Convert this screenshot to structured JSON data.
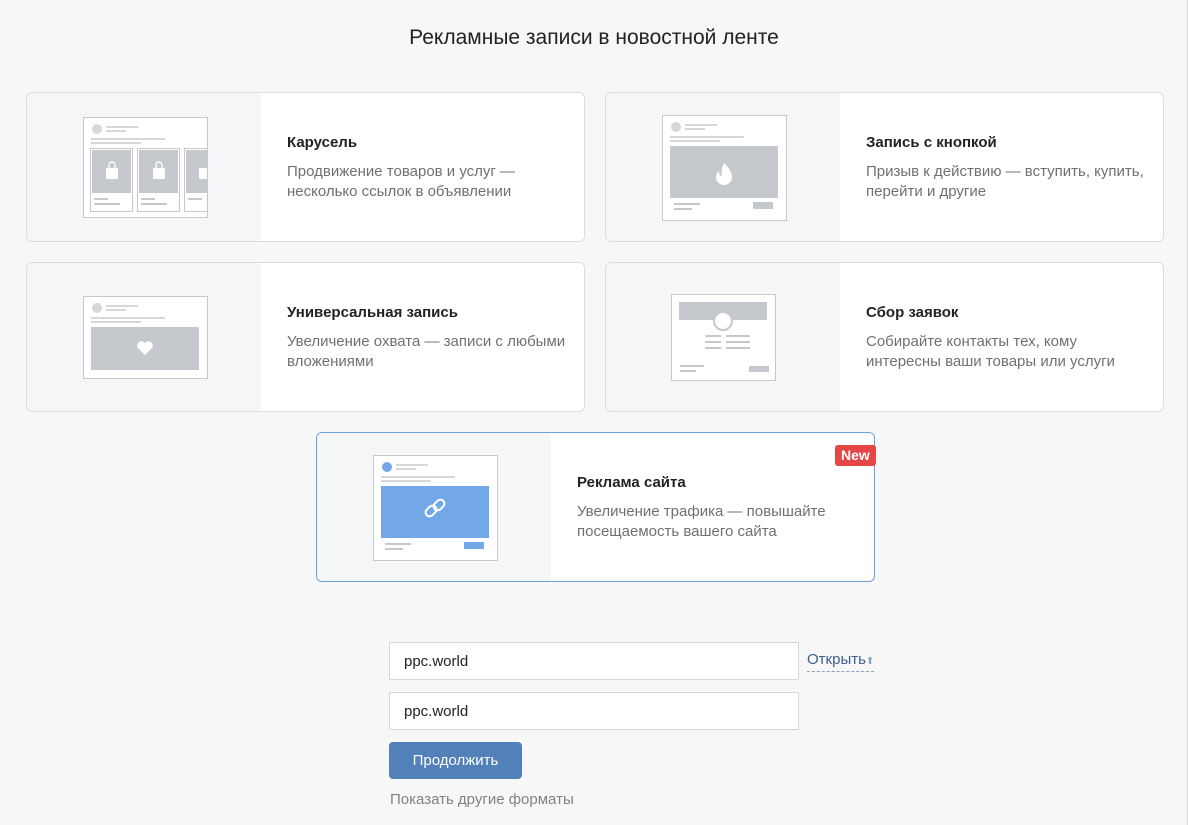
{
  "page": {
    "title": "Рекламные записи в новостной ленте"
  },
  "formats": [
    {
      "name": "Карусель",
      "desc_line1": "Продвижение товаров и услуг —",
      "desc_line2": "несколько ссылок в объявлении"
    },
    {
      "name": "Запись с кнопкой",
      "desc_line1": "Призыв к действию — вступить, купить,",
      "desc_line2": "перейти и другие"
    },
    {
      "name": "Универсальная запись",
      "desc_line1": "Увеличение охвата — записи с любыми",
      "desc_line2": "вложениями"
    },
    {
      "name": "Сбор заявок",
      "desc_line1": "Собирайте контакты тех, кому",
      "desc_line2": "интересны ваши товары или услуги"
    },
    {
      "name": "Реклама сайта",
      "desc_line1": "Увеличение трафика — повышайте",
      "desc_line2": "посещаемость вашего сайта",
      "badge": "New"
    }
  ],
  "form": {
    "url_value": "ppc.world",
    "title_value": "ppc.world",
    "open_link": "Открыть",
    "continue_label": "Продолжить",
    "other_formats": "Показать другие форматы"
  },
  "colors": {
    "accent": "#5181b8",
    "badge": "#e64646",
    "selected_border": "#6fa0dc",
    "preview_blue": "#72a7e8"
  },
  "icons": [
    "bag-icon",
    "fire-icon",
    "heart-icon",
    "link-icon",
    "arrow-up-icon"
  ]
}
